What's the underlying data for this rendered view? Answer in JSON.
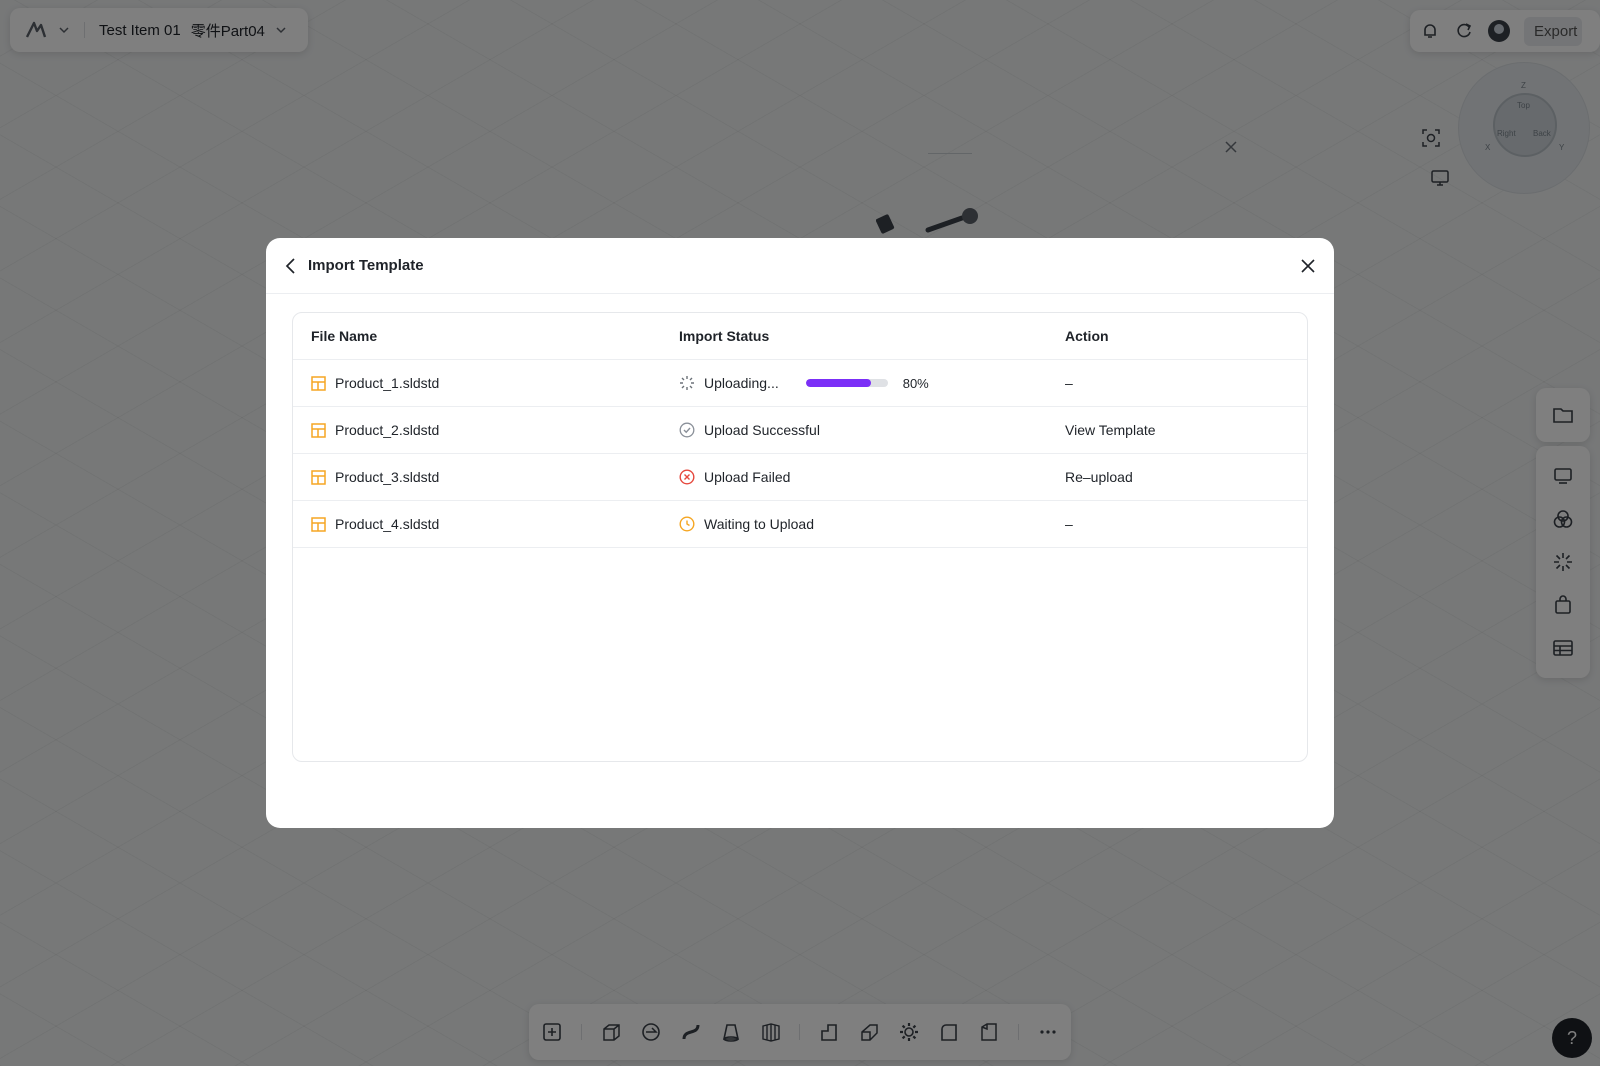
{
  "topbar": {
    "project": "Test Item 01",
    "part": "零件Part04",
    "export_label": "Export"
  },
  "navcube": {
    "faces": [
      "Top",
      "Right",
      "Back"
    ],
    "axes": [
      "Z",
      "X",
      "Y"
    ]
  },
  "modal": {
    "title": "Import Template",
    "columns": [
      "File Name",
      "Import Status",
      "Action"
    ],
    "rows": [
      {
        "file": "Product_1.sldstd",
        "status": "Uploading...",
        "status_type": "uploading",
        "progress": 0.8,
        "progress_label": "80%",
        "action": "–"
      },
      {
        "file": "Product_2.sldstd",
        "status": "Upload Successful",
        "status_type": "success",
        "action": "View Template"
      },
      {
        "file": "Product_3.sldstd",
        "status": "Upload Failed",
        "status_type": "failed",
        "action": "Re–upload"
      },
      {
        "file": "Product_4.sldstd",
        "status": "Waiting to Upload",
        "status_type": "waiting",
        "action": "–"
      }
    ]
  },
  "help_label": "?",
  "colors": {
    "accent": "#7b2ff7",
    "file_icon": "#f5a623",
    "failed": "#e5483d",
    "waiting": "#f5a623",
    "success": "#8a9099"
  }
}
